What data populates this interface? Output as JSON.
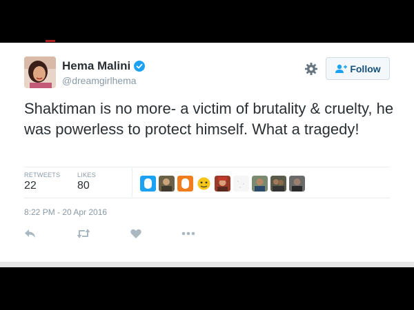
{
  "user": {
    "display_name": "Hema Malini",
    "handle": "@dreamgirlhema",
    "verified": true
  },
  "header": {
    "follow_label": "Follow"
  },
  "tweet": {
    "text": "Shaktiman is no more- a victim of brutality & cruelty, he was powerless to protect himself. What a tragedy!"
  },
  "stats": {
    "retweets_label": "RETWEETS",
    "retweets_count": "22",
    "likes_label": "LIKES",
    "likes_count": "80"
  },
  "timestamp": "8:22 PM - 20 Apr 2016",
  "colors": {
    "accent": "#1da1f2",
    "follow_text": "#14507a",
    "muted": "#8899a6",
    "text": "#292f33",
    "icon": "#aab8c2"
  },
  "icons": [
    "verified-badge-icon",
    "gear-icon",
    "add-user-icon",
    "reply-icon",
    "retweet-icon",
    "like-icon",
    "more-icon"
  ]
}
